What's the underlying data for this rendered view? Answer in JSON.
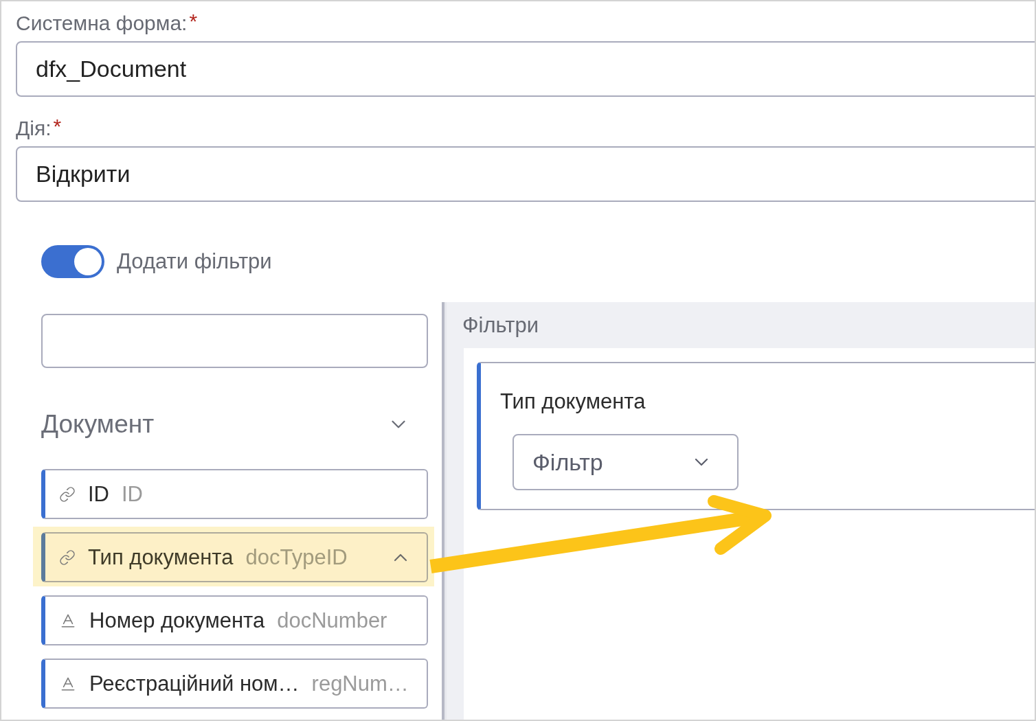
{
  "form": {
    "fields": [
      {
        "label": "Системна форма:",
        "required_mark": "*",
        "value": "dfx_Document"
      },
      {
        "label": "Дія:",
        "required_mark": "*",
        "value": "Відкрити"
      }
    ]
  },
  "filters_toggle": {
    "label": "Додати фільтри",
    "on": true
  },
  "field_picker": {
    "group": {
      "title": "Документ",
      "expanded": true
    },
    "items": [
      {
        "kind": "link",
        "label": "ID",
        "code": "ID",
        "selected": false
      },
      {
        "kind": "link",
        "label": "Тип документа",
        "code": "docTypeID",
        "selected": true
      },
      {
        "kind": "text",
        "label": "Номер документа",
        "code": "docNumber",
        "selected": false
      },
      {
        "kind": "text",
        "label": "Реєстраційний ном…",
        "code": "regNum…",
        "selected": false
      }
    ]
  },
  "filters_panel": {
    "title": "Фільтри",
    "filters": [
      {
        "label": "Тип документа",
        "select": {
          "placeholder": "Фільтр"
        }
      }
    ]
  }
}
